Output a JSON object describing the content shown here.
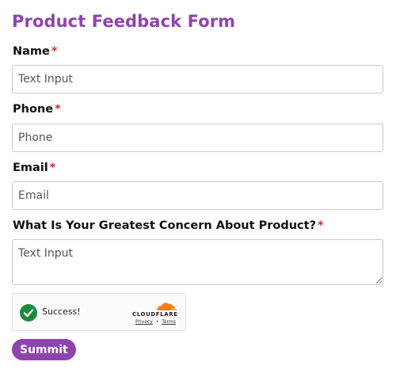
{
  "form": {
    "title": "Product Feedback Form",
    "required_marker": "*",
    "fields": {
      "name": {
        "label": "Name",
        "placeholder": "Text Input"
      },
      "phone": {
        "label": "Phone",
        "placeholder": "Phone"
      },
      "email": {
        "label": "Email",
        "placeholder": "Email"
      },
      "concern": {
        "label": "What Is Your Greatest Concern About Product?",
        "placeholder": "Text Input"
      }
    },
    "submit_label": "Summit"
  },
  "captcha": {
    "status": "Success!",
    "brand": "CLOUDFLARE",
    "privacy_link": "Privacy",
    "separator": "•",
    "terms_link": "Terms",
    "colors": {
      "success": "#1a8c3a",
      "brand_orange": "#f38020",
      "brand_light_orange": "#faae40"
    }
  },
  "theme": {
    "accent": "#8e44ad",
    "required": "#c9302c"
  }
}
